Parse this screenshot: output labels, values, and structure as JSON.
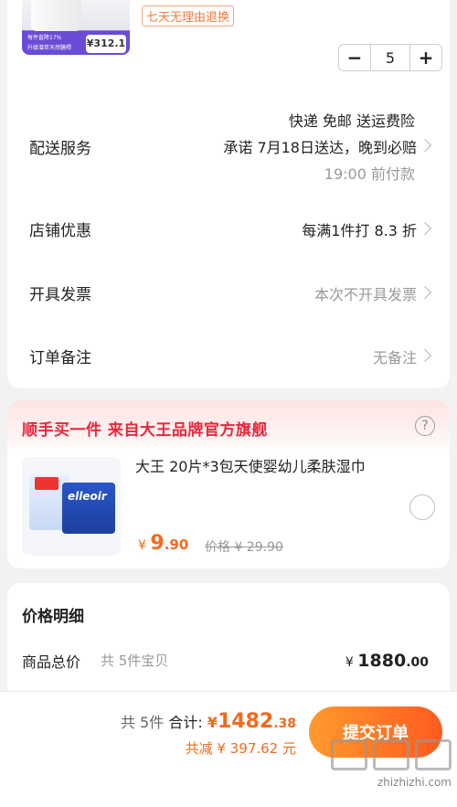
{
  "product": {
    "thumb_tag1": "每件直降17%",
    "thumb_tag2": "升级潜萃天然膳喂",
    "thumb_price": "¥312.1",
    "return_tag": "七天无理由退换",
    "quantity": "5",
    "minus": "−",
    "plus": "+"
  },
  "delivery": {
    "label": "配送服务",
    "line1": "快递 免邮 送运费险",
    "line2": "承诺 7月18日送达，晚到必赔",
    "line3": "19:00 前付款"
  },
  "store_discount": {
    "label": "店铺优惠",
    "value": "每满1件打 8.3 折"
  },
  "invoice": {
    "label": "开具发票",
    "value": "本次不开具发票"
  },
  "note": {
    "label": "订单备注",
    "value": "无备注"
  },
  "addon": {
    "title": "顺手买一件  来自大王品牌官方旗舰",
    "help": "?",
    "image_brand": "elleoir",
    "name": "大王 20片*3包天使婴幼儿柔肤湿巾",
    "price_symbol": "¥",
    "price_int": "9",
    "price_dec": ".90",
    "original_price": "价格 ¥ 29.90"
  },
  "price_detail": {
    "title": "价格明细",
    "total_label": "商品总价",
    "total_count": "共 5件宝贝",
    "total_symbol": "¥",
    "total_int": "1880",
    "total_dec": ".00"
  },
  "bottom_bar": {
    "count": "共 5件",
    "total_label": "合计:",
    "currency": "¥",
    "total_int": "1482",
    "total_dec": ".38",
    "saved": "共减 ¥ 397.62 元",
    "submit": "提交订单"
  },
  "watermark": {
    "site": "zhizhizhi.com"
  }
}
